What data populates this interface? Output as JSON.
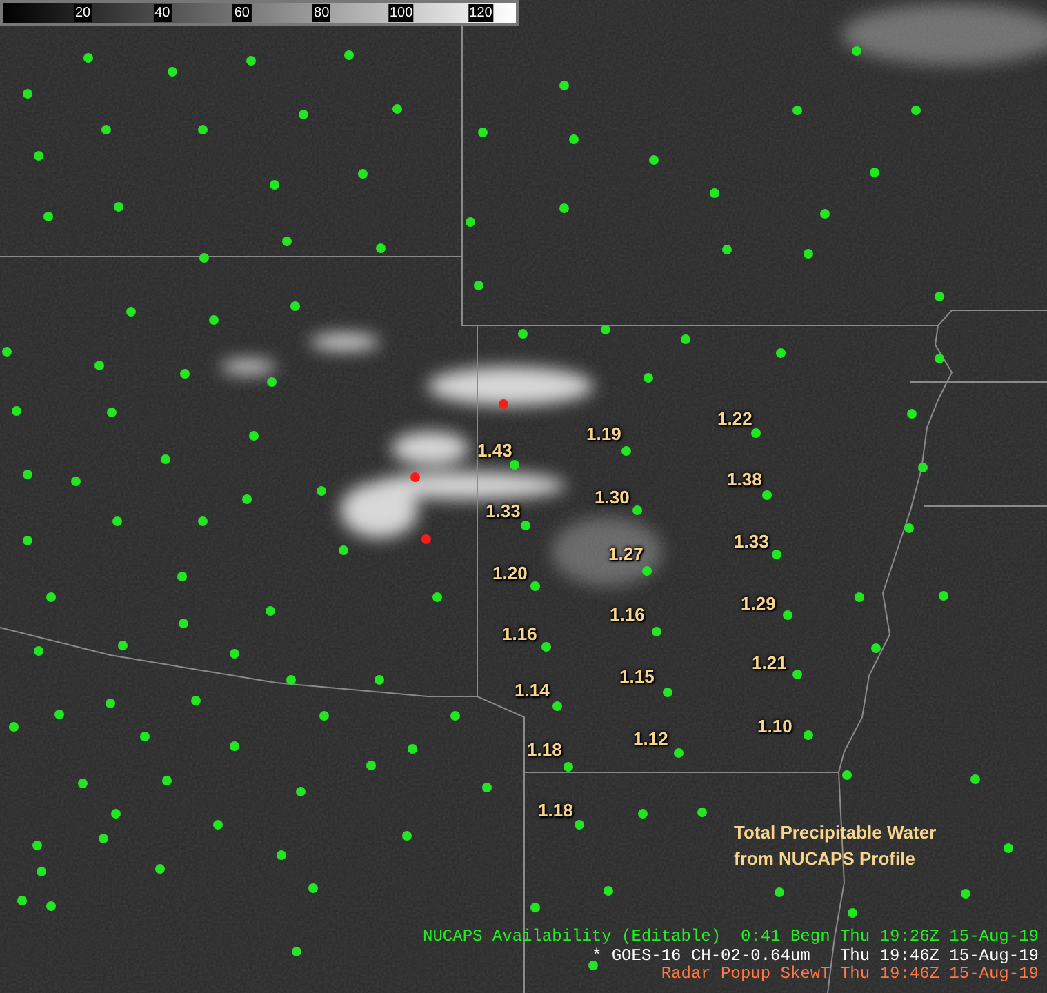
{
  "colorbar": {
    "ticks": [
      "20",
      "40",
      "60",
      "80",
      "100",
      "120"
    ]
  },
  "stations": [
    {
      "value": "1.22"
    },
    {
      "value": "1.19"
    },
    {
      "value": "1.43"
    },
    {
      "value": "1.38"
    },
    {
      "value": "1.30"
    },
    {
      "value": "1.33"
    },
    {
      "value": "1.33"
    },
    {
      "value": "1.27"
    },
    {
      "value": "1.20"
    },
    {
      "value": "1.29"
    },
    {
      "value": "1.16"
    },
    {
      "value": "1.16"
    },
    {
      "value": "1.21"
    },
    {
      "value": "1.15"
    },
    {
      "value": "1.14"
    },
    {
      "value": "1.10"
    },
    {
      "value": "1.12"
    },
    {
      "value": "1.18"
    },
    {
      "value": "1.18"
    }
  ],
  "caption": [
    "Total Precipitable Water",
    "from NUCAPS Profile"
  ],
  "legend": [
    {
      "kind": "nucaps",
      "text": "NUCAPS Availability (Editable)  0:41 Begn Thu 19:26Z 15-Aug-19"
    },
    {
      "kind": "satellite",
      "text": "* GOES-16 CH-02-0.64um   Thu 19:46Z 15-Aug-19"
    },
    {
      "kind": "radar",
      "text": "Radar Popup SkewT Thu 19:46Z 15-Aug-19"
    }
  ]
}
